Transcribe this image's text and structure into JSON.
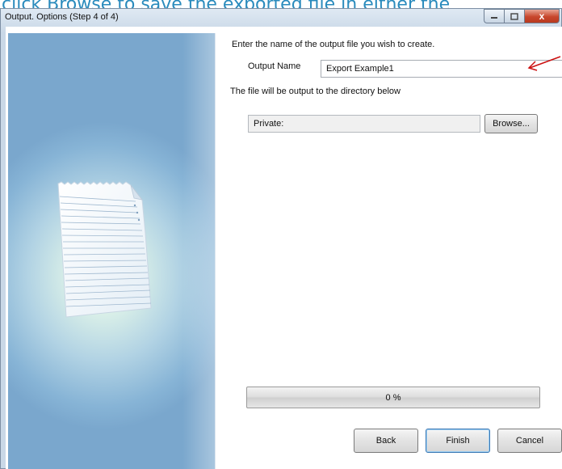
{
  "caption": "click Browse to save the exported file in either the",
  "window": {
    "title": "Output. Options (Step 4 of 4)",
    "controls": {
      "minimize_icon": "minimize-icon",
      "maximize_icon": "maximize-icon",
      "close_icon": "close-icon",
      "close_glyph": "x"
    }
  },
  "side_panel": {
    "illustration_icon": "document-page-icon"
  },
  "form": {
    "instruction": "Enter the name of the output file you wish to create.",
    "output_name_label": "Output Name",
    "output_name_value": "Export Example1",
    "directory_instruction": "The file will be output to the directory below",
    "directory_value": "Private:",
    "browse_label": "Browse..."
  },
  "progress": {
    "value": 0,
    "label": "0 %"
  },
  "buttons": {
    "back": "Back",
    "finish": "Finish",
    "cancel": "Cancel"
  },
  "colors": {
    "caption": "#2a8bbd",
    "arrow": "#cc1111",
    "close_button": "#c8462c"
  }
}
